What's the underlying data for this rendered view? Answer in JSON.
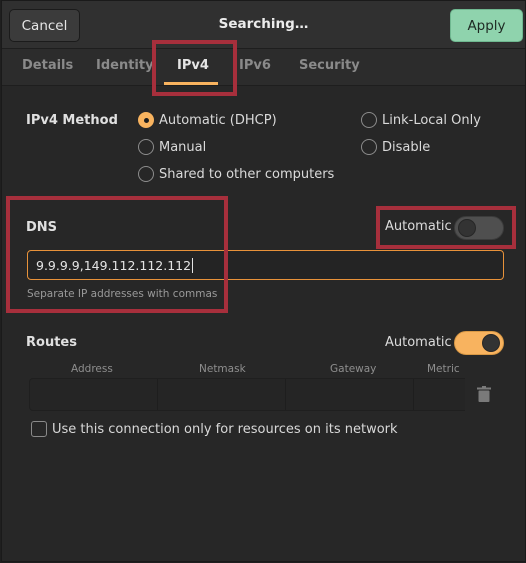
{
  "header": {
    "cancel_label": "Cancel",
    "title": "Searching…",
    "apply_label": "Apply"
  },
  "tabs": [
    {
      "label": "Details",
      "active": false
    },
    {
      "label": "Identity",
      "active": false
    },
    {
      "label": "IPv4",
      "active": true
    },
    {
      "label": "IPv6",
      "active": false
    },
    {
      "label": "Security",
      "active": false
    }
  ],
  "ipv4_method": {
    "label": "IPv4 Method",
    "options": [
      {
        "label": "Automatic (DHCP)",
        "selected": true
      },
      {
        "label": "Link-Local Only",
        "selected": false
      },
      {
        "label": "Manual",
        "selected": false
      },
      {
        "label": "Disable",
        "selected": false
      },
      {
        "label": "Shared to other computers",
        "selected": false
      }
    ]
  },
  "dns": {
    "label": "DNS",
    "automatic_label": "Automatic",
    "automatic_on": false,
    "value": "9.9.9.9,149.112.112.112",
    "hint": "Separate IP addresses with commas"
  },
  "routes": {
    "label": "Routes",
    "automatic_label": "Automatic",
    "automatic_on": true,
    "columns": [
      "Address",
      "Netmask",
      "Gateway",
      "Metric"
    ],
    "delete_icon": "trash-icon"
  },
  "only_local_resources": {
    "label": "Use this connection only for resources on its network",
    "checked": false
  },
  "colors": {
    "accent": "#f8b35f",
    "apply_button": "#8fd3ad",
    "highlight": "#a72f3c",
    "background": "#272727"
  }
}
